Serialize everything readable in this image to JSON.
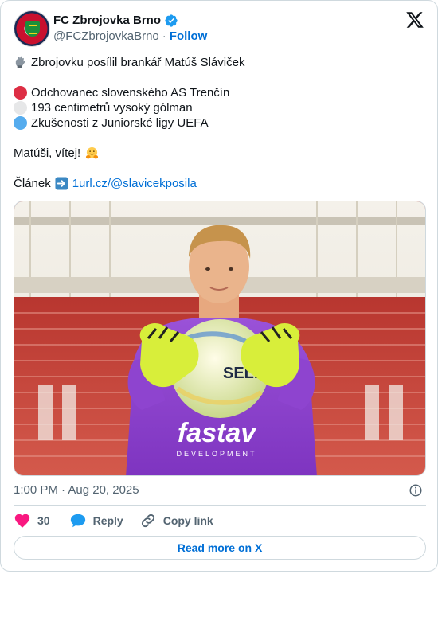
{
  "author": {
    "display_name": "FC Zbrojovka Brno",
    "handle": "@FCZbrojovkaBrno",
    "separator": "·",
    "follow_label": "Follow",
    "verified_icon": "verified-badge-icon"
  },
  "tweet": {
    "lines": [
      {
        "icon": "gloves-emoji",
        "text": "Zbrojovku posílil brankář Matúš Sláviček"
      },
      {
        "icon": "red-circle",
        "color": "#dd2e44",
        "text": "Odchovanec slovenského AS Trenčín"
      },
      {
        "icon": "white-circle",
        "color": "#e6e7e8",
        "text": "193 centimetrů vysoký gólman"
      },
      {
        "icon": "blue-circle",
        "color": "#55acee",
        "text": "Zkušenosti z Juniorské ligy UEFA"
      }
    ],
    "greeting": "Matúši, vítej!",
    "greeting_icon": "hugging-face-emoji",
    "article_label": "Článek",
    "article_icon": "right-arrow-emoji",
    "link_text": "1url.cz/@slavicekposila"
  },
  "photo": {
    "jersey_text": "fastav",
    "jersey_subtext": "DEVELOPMENT",
    "ball_text": "SELE"
  },
  "meta": {
    "timestamp": "1:00 PM · Aug 20, 2025"
  },
  "actions": {
    "like_count": "30",
    "reply_label": "Reply",
    "copy_label": "Copy link"
  },
  "read_more_label": "Read more on X",
  "colors": {
    "link": "#006fd6",
    "like": "#f91880",
    "reply": "#1d9bf0",
    "muted": "#536471",
    "border": "#cfd9de"
  }
}
